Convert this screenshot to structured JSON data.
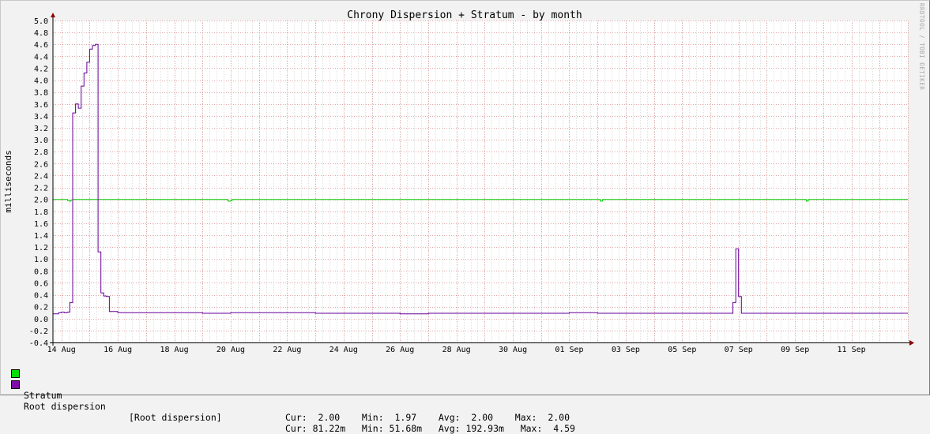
{
  "chart_data": {
    "type": "line",
    "title": "Chrony Dispersion + Stratum - by month",
    "ylabel": "milliseconds",
    "ylim": [
      -0.4,
      5.0
    ],
    "yticks": [
      -0.4,
      -0.2,
      0.0,
      0.2,
      0.4,
      0.6,
      0.8,
      1.0,
      1.2,
      1.4,
      1.6,
      1.8,
      2.0,
      2.2,
      2.4,
      2.6,
      2.8,
      3.0,
      3.2,
      3.4,
      3.6,
      3.8,
      4.0,
      4.2,
      4.4,
      4.6,
      4.8,
      5.0
    ],
    "x_axis_unit": "days since 12 Aug 00:00",
    "xlim": [
      1.7,
      32.0
    ],
    "x_ticks": [
      {
        "x": 2,
        "label": "14 Aug"
      },
      {
        "x": 4,
        "label": "16 Aug"
      },
      {
        "x": 6,
        "label": "18 Aug"
      },
      {
        "x": 8,
        "label": "20 Aug"
      },
      {
        "x": 10,
        "label": "22 Aug"
      },
      {
        "x": 12,
        "label": "24 Aug"
      },
      {
        "x": 14,
        "label": "26 Aug"
      },
      {
        "x": 16,
        "label": "28 Aug"
      },
      {
        "x": 18,
        "label": "30 Aug"
      },
      {
        "x": 20,
        "label": "01 Sep"
      },
      {
        "x": 22,
        "label": "03 Sep"
      },
      {
        "x": 24,
        "label": "05 Sep"
      },
      {
        "x": 26,
        "label": "07 Sep"
      },
      {
        "x": 28,
        "label": "09 Sep"
      },
      {
        "x": 30,
        "label": "11 Sep"
      }
    ],
    "grid": true,
    "series": [
      {
        "name": "Stratum",
        "color": "#00cc00",
        "x": [
          1.7,
          2.18,
          2.22,
          2.28,
          2.34,
          2.4,
          7.85,
          7.9,
          8.0,
          8.05,
          21.05,
          21.1,
          21.18,
          28.35,
          28.4,
          28.47,
          32.0
        ],
        "values": [
          2.0,
          2.0,
          1.98,
          1.97,
          1.99,
          2.0,
          2.0,
          1.97,
          1.98,
          2.0,
          2.0,
          1.97,
          2.0,
          2.0,
          1.97,
          2.0,
          2.0
        ]
      },
      {
        "name": "Root dispersion",
        "color": "#660099",
        "x": [
          1.7,
          1.9,
          1.95,
          2.0,
          2.1,
          2.2,
          2.3,
          2.4,
          2.5,
          2.6,
          2.7,
          2.8,
          2.9,
          3.0,
          3.1,
          3.2,
          3.3,
          3.4,
          3.5,
          3.6,
          3.7,
          4.0,
          5.0,
          6.0,
          7.0,
          8.0,
          9.0,
          10.0,
          11.0,
          12.0,
          13.0,
          14.0,
          15.0,
          16.0,
          17.0,
          18.0,
          19.0,
          20.0,
          21.0,
          22.0,
          23.0,
          24.0,
          25.0,
          25.7,
          25.8,
          25.9,
          26.0,
          26.1,
          27.0,
          28.0,
          29.0,
          30.0,
          31.0,
          32.0
        ],
        "values": [
          0.08,
          0.1,
          0.1,
          0.11,
          0.1,
          0.11,
          0.27,
          3.45,
          3.6,
          3.53,
          3.9,
          4.12,
          4.3,
          4.52,
          4.58,
          4.6,
          1.12,
          0.43,
          0.38,
          0.37,
          0.12,
          0.1,
          0.1,
          0.1,
          0.09,
          0.1,
          0.1,
          0.1,
          0.09,
          0.09,
          0.09,
          0.08,
          0.09,
          0.09,
          0.09,
          0.09,
          0.09,
          0.1,
          0.09,
          0.09,
          0.09,
          0.09,
          0.09,
          0.09,
          0.27,
          1.17,
          0.37,
          0.09,
          0.09,
          0.09,
          0.09,
          0.09,
          0.09,
          0.09
        ]
      }
    ]
  },
  "legend": [
    {
      "name": "Stratum",
      "color": "#00dd00",
      "desc": "",
      "stats": "Cur:  2.00    Min:  1.97    Avg:  2.00    Max:  2.00"
    },
    {
      "name": "Root dispersion",
      "color": "#7e0ca8",
      "desc": "[Root dispersion]",
      "stats": "Cur: 81.22m   Min: 51.68m   Avg: 192.93m   Max:  4.59"
    }
  ],
  "watermark": "RRDTOOL / TOBI OETIKER"
}
